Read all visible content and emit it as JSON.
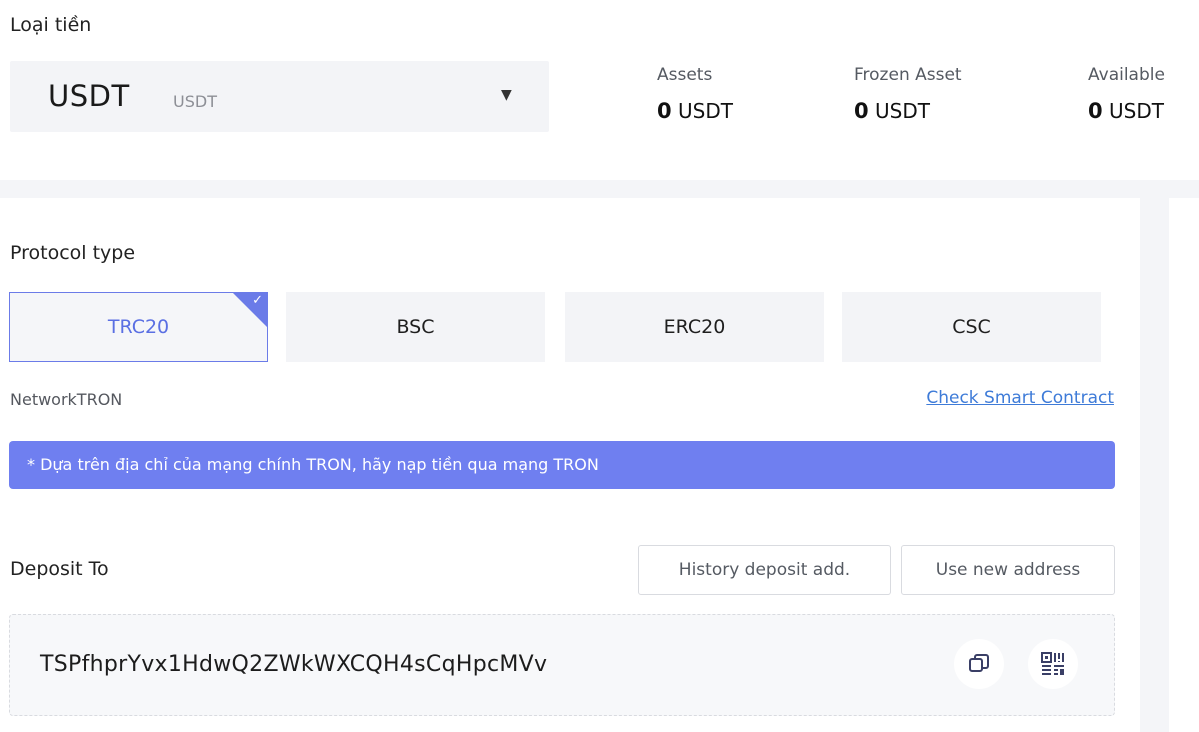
{
  "currency": {
    "label": "Loại tiền",
    "selected_symbol": "USDT",
    "selected_name": "USDT",
    "caret": "▼"
  },
  "stats": {
    "assets": {
      "label": "Assets",
      "amount": "0",
      "unit": "USDT"
    },
    "frozen": {
      "label": "Frozen Asset",
      "amount": "0",
      "unit": "USDT"
    },
    "available": {
      "label": "Available",
      "amount": "0",
      "unit": "USDT"
    }
  },
  "protocol": {
    "title": "Protocol type",
    "tabs": [
      {
        "label": "TRC20",
        "active": true
      },
      {
        "label": "BSC",
        "active": false
      },
      {
        "label": "ERC20",
        "active": false
      },
      {
        "label": "CSC",
        "active": false
      }
    ],
    "check_mark": "✓"
  },
  "network": {
    "text": "NetworkTRON",
    "check_contract_link": "Check Smart Contract"
  },
  "notice": {
    "text": "* Dựa trên địa chỉ của mạng chính TRON, hãy nạp tiền qua mạng TRON",
    "color": "#6f7ff0"
  },
  "deposit": {
    "title": "Deposit To",
    "history_button": "History deposit add.",
    "new_address_button": "Use new address",
    "address": "TSPfhprYvx1HdwQ2ZWkWXCQH4sCqHpcMVv"
  },
  "colors": {
    "accent": "#6b7be8",
    "link": "#3e7bd8",
    "tab_bg": "#f3f4f7"
  }
}
